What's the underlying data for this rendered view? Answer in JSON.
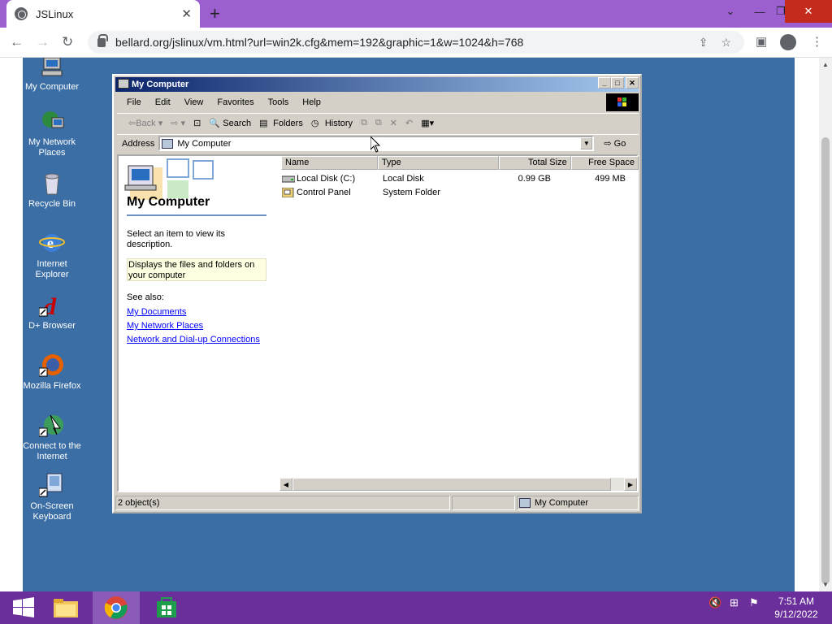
{
  "browser": {
    "tab_title": "JSLinux",
    "tab_close": "✕",
    "new_tab": "+",
    "url": "bellard.org/jslinux/vm.html?url=win2k.cfg&mem=192&graphic=1&w=1024&h=768",
    "win_controls": {
      "chevron": "⌄",
      "minimize": "—",
      "restore": "❐",
      "close": "✕"
    }
  },
  "desktop_icons": [
    {
      "label": "My Computer"
    },
    {
      "label": "My Network Places"
    },
    {
      "label": "Recycle Bin"
    },
    {
      "label": "Internet Explorer"
    },
    {
      "label": "D+ Browser"
    },
    {
      "label": "Mozilla Firefox"
    },
    {
      "label": "Connect to the Internet"
    },
    {
      "label": "On-Screen Keyboard"
    }
  ],
  "explorer": {
    "title": "My Computer",
    "menu": [
      "File",
      "Edit",
      "View",
      "Favorites",
      "Tools",
      "Help"
    ],
    "toolbar": {
      "back": "Back",
      "search": "Search",
      "folders": "Folders",
      "history": "History"
    },
    "address_label": "Address",
    "address_value": "My Computer",
    "go_label": "Go",
    "left_pane": {
      "title": "My Computer",
      "prompt": "Select an item to view its description.",
      "description": "Displays the files and folders on your computer",
      "see_also": "See also:",
      "links": [
        "My Documents",
        "My Network Places",
        "Network and Dial-up Connections"
      ]
    },
    "columns": [
      "Name",
      "Type",
      "Total Size",
      "Free Space"
    ],
    "rows": [
      {
        "name": "Local Disk (C:)",
        "type": "Local Disk",
        "total": "0.99 GB",
        "free": "499 MB"
      },
      {
        "name": "Control Panel",
        "type": "System Folder",
        "total": "",
        "free": ""
      }
    ],
    "status": {
      "count": "2 object(s)",
      "zone": "My Computer"
    }
  },
  "clock": {
    "time": "7:51 AM",
    "date": "9/12/2022"
  }
}
